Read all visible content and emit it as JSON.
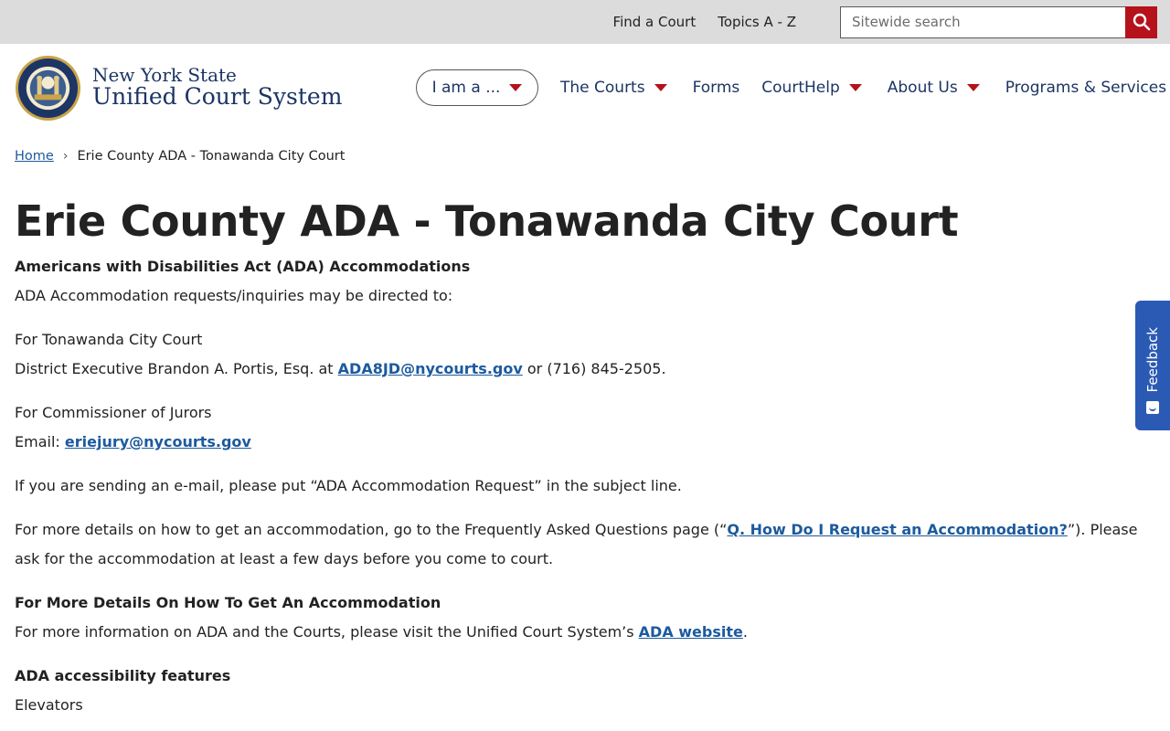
{
  "utility": {
    "find_court": "Find a Court",
    "topics": "Topics A - Z",
    "search_placeholder": "Sitewide search"
  },
  "logo": {
    "line1": "New York State",
    "line2": "Unified Court System"
  },
  "nav": {
    "iam": "I am a ...",
    "courts": "The Courts",
    "forms": "Forms",
    "courthelp": "CourtHelp",
    "about": "About Us",
    "programs": "Programs & Services"
  },
  "breadcrumb": {
    "home": "Home",
    "current": "Erie County ADA - Tonawanda City Court"
  },
  "content": {
    "title": "Erie County ADA - Tonawanda City Court",
    "ada_heading": "Americans with Disabilities Act (ADA) Accommodations",
    "ada_intro": "ADA Accommodation requests/inquiries may be directed to:",
    "tonawanda_label": "For Tonawanda City Court",
    "district_exec_prefix": "District Executive Brandon A. Portis, Esq. at ",
    "district_exec_email": "ADA8JD@nycourts.gov",
    "district_exec_suffix": " or (716) 845-2505.",
    "jurors_label": "For Commissioner of Jurors",
    "email_prefix": "Email: ",
    "jurors_email": "eriejury@nycourts.gov",
    "subject_line": "If you are sending an e-mail, please put “ADA Accommodation Request” in the subject line.",
    "faq_prefix": "For more details on how to get an accommodation, go to the Frequently Asked Questions page (“",
    "faq_link": "Q. How Do I Request an Accommodation?",
    "faq_suffix": "”). Please ask for the accommodation at least a few days before you come to court.",
    "more_details_heading": "For More Details On How To Get An Accommodation",
    "more_info_prefix": "For more information on ADA and the Courts, please visit the Unified Court System’s ",
    "ada_website_link": "ADA website",
    "more_info_suffix": ".",
    "features_heading": "ADA accessibility features",
    "elevators": "Elevators"
  },
  "feedback": {
    "label": "Feedback"
  },
  "colors": {
    "brand_navy": "#1c3564",
    "accent_red": "#b5121b",
    "link_blue": "#1c5a9e",
    "feedback_blue": "#2b5ab5"
  }
}
